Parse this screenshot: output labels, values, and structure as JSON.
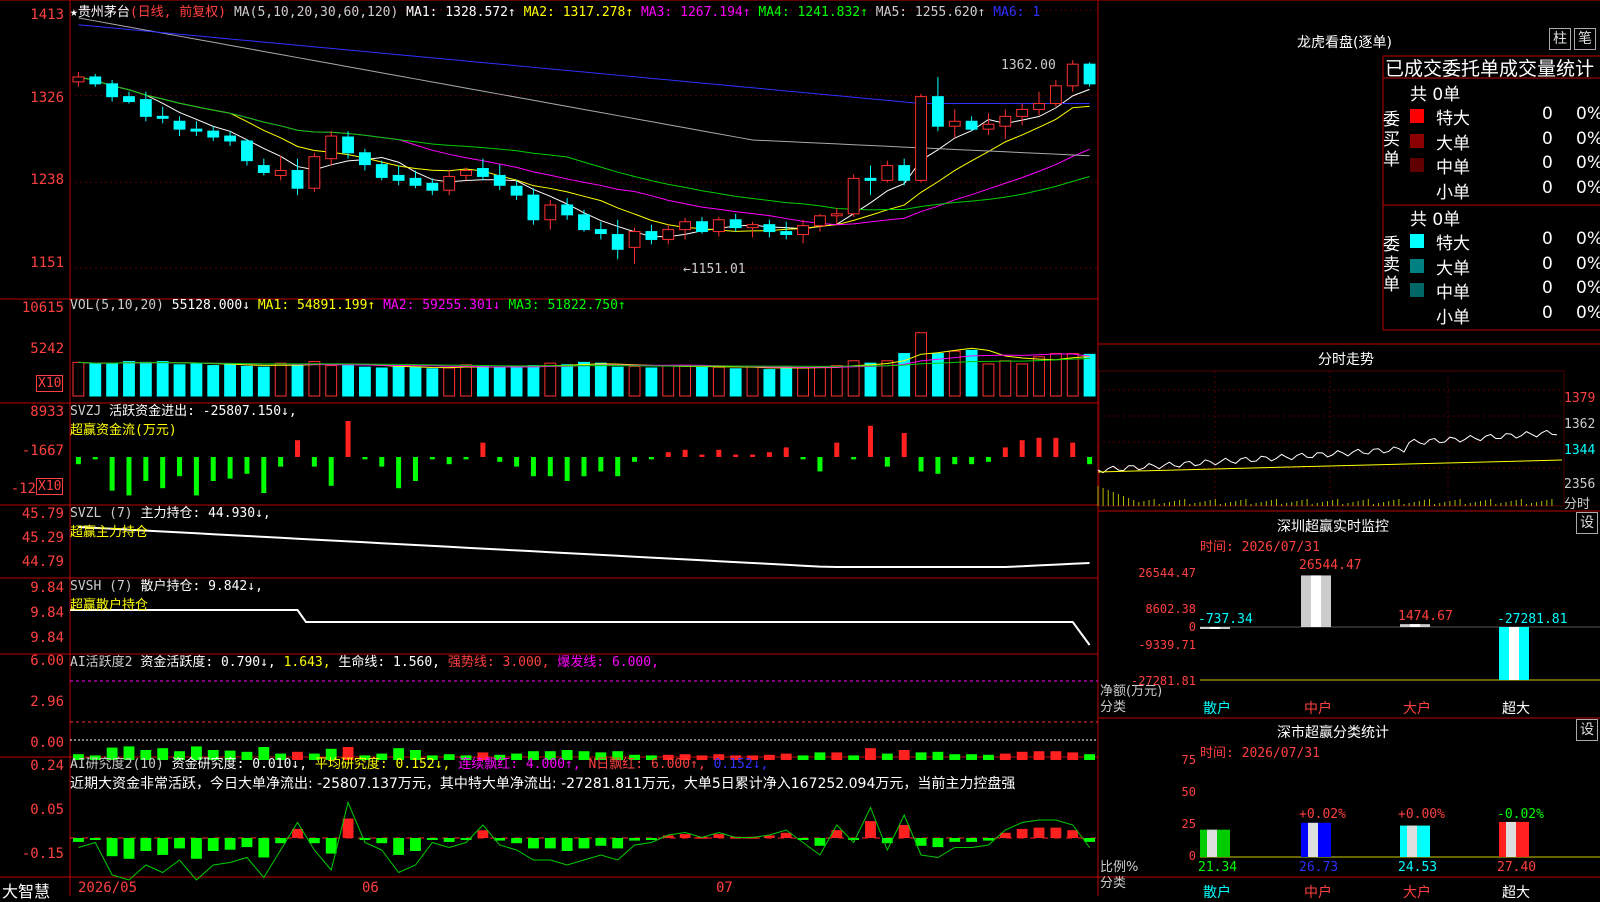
{
  "stock": {
    "name": "★贵州茅台",
    "mode": "(日线, 前复权)",
    "logo": "大智慧"
  },
  "price": {
    "header": {
      "ma_label": "MA(5,10,20,30,60,120)",
      "ma1": "MA1: 1328.572↑",
      "ma2": "MA2: 1317.278↑",
      "ma3": "MA3: 1267.194↑",
      "ma4": "MA4: 1241.832↑",
      "ma5": "MA5: 1255.620↑",
      "ma6": "MA6: 1"
    },
    "yticks": [
      "1413",
      "1326",
      "1238",
      "1151"
    ],
    "high_label": "1362.00",
    "low_label": "←1151.01"
  },
  "vol": {
    "header": {
      "label": "VOL(5,10,20)",
      "val": "55128.000↓",
      "ma1": "MA1: 54891.199↑",
      "ma2": "MA2: 59255.301↓",
      "ma3": "MA3: 51822.750↑"
    },
    "yticks": [
      "10615",
      "5242"
    ],
    "unit": "X10"
  },
  "svzj": {
    "header": {
      "label": "SVZJ",
      "text": "活跃资金进出: -25807.150↓,"
    },
    "sub": "超赢资金流(万元)",
    "yticks": [
      "8933",
      "-1667",
      "-12"
    ],
    "unit": "X10"
  },
  "svzl": {
    "header": {
      "label": "SVZL (7)",
      "text": "主力持仓: 44.930↓,"
    },
    "sub": "超赢主力持仓",
    "yticks": [
      "45.79",
      "45.29",
      "44.79"
    ]
  },
  "svsh": {
    "header": {
      "label": "SVSH (7)",
      "text": "散户持仓: 9.842↓,"
    },
    "sub": "超赢散户持仓",
    "yticks": [
      "9.84",
      "9.84",
      "9.84"
    ]
  },
  "ai1": {
    "header": {
      "label": "AI活跃度2",
      "t1": "资金活跃度: 0.790↓,",
      "t2": "1.643,",
      "t3": "生命线: 1.560,",
      "t4": "强势线: 3.000,",
      "t5": "爆发线: 6.000,"
    },
    "yticks": [
      "6.00",
      "2.96",
      "0.00"
    ]
  },
  "ai2": {
    "header": {
      "label": "AI研究度2(10)",
      "t1": "资金研究度: 0.010↓,",
      "t2": "平均研究度: 0.152↓,",
      "t3": "连续飘红: 4.000↑,",
      "t4": "N日飘红: 6.000↑,",
      "t5": "0.152↓,"
    },
    "note": "近期大资金非常活跃，今日大单净流出: -25807.137万元，其中特大单净流出: -27281.811万元，大单5日累计净入167252.094万元，当前主力控盘强",
    "yticks": [
      "0.24",
      "0.05",
      "-0.15"
    ]
  },
  "xaxis": [
    "2026/05",
    "06",
    "07"
  ],
  "lhb": {
    "title": "龙虎看盘(逐单)",
    "btn1": "柱",
    "btn2": "笔",
    "subtitle": "已成交委托单成交量统计",
    "buy": {
      "side": "委买单",
      "total": "共 0单",
      "rows": [
        {
          "label": "特大",
          "count": "0",
          "pct": "0%",
          "color": "#ff0000"
        },
        {
          "label": "大单",
          "count": "0",
          "pct": "0%",
          "color": "#8b0000"
        },
        {
          "label": "中单",
          "count": "0",
          "pct": "0%",
          "color": "#600000"
        },
        {
          "label": "小单",
          "count": "0",
          "pct": "0%",
          "color": "#000"
        }
      ]
    },
    "sell": {
      "side": "委卖单",
      "total": "共 0单",
      "rows": [
        {
          "label": "特大",
          "count": "0",
          "pct": "0%",
          "color": "#00ffff"
        },
        {
          "label": "大单",
          "count": "0",
          "pct": "0%",
          "color": "#008080"
        },
        {
          "label": "中单",
          "count": "0",
          "pct": "0%",
          "color": "#006666"
        },
        {
          "label": "小单",
          "count": "0",
          "pct": "0%",
          "color": "#000"
        }
      ]
    }
  },
  "fenshi": {
    "title": "分时走势",
    "yticks": [
      "1379",
      "1362",
      "1344",
      "2356",
      "分时"
    ]
  },
  "monitor": {
    "title": "深圳超赢实时监控",
    "btn": "设",
    "time": "时间: 2026/07/31",
    "yticks": [
      "26544.47",
      "8602.38",
      "0",
      "-9339.71",
      "-27281.81"
    ],
    "ylabel1": "净额(万元)",
    "ylabel2": "分类",
    "cats": [
      "散户",
      "中户",
      "大户",
      "超大"
    ],
    "vals": [
      "-737.34",
      "26544.47",
      "1474.67",
      "-27281.81"
    ]
  },
  "cls": {
    "title": "深市超赢分类统计",
    "btn": "设",
    "time": "时间: 2026/07/31",
    "yticks": [
      "75",
      "50",
      "25",
      "0"
    ],
    "ylabel1": "比例%",
    "ylabel2": "分类",
    "cats": [
      "散户",
      "中户",
      "大户",
      "超大"
    ],
    "vals": [
      "21.34",
      "26.73",
      "24.53",
      "27.40"
    ],
    "changes": [
      "",
      "+0.02%",
      "+0.00%",
      "-0.02%"
    ]
  },
  "chart_data": {
    "type": "bar",
    "title": "贵州茅台",
    "candles": [
      [
        1340,
        1350,
        1335,
        1345
      ],
      [
        1345,
        1348,
        1335,
        1338
      ],
      [
        1338,
        1342,
        1320,
        1325
      ],
      [
        1325,
        1330,
        1318,
        1320
      ],
      [
        1322,
        1330,
        1300,
        1305
      ],
      [
        1305,
        1315,
        1298,
        1303
      ],
      [
        1300,
        1305,
        1285,
        1292
      ],
      [
        1292,
        1300,
        1285,
        1290
      ],
      [
        1290,
        1295,
        1280,
        1284
      ],
      [
        1285,
        1290,
        1275,
        1280
      ],
      [
        1280,
        1282,
        1255,
        1260
      ],
      [
        1255,
        1262,
        1245,
        1248
      ],
      [
        1245,
        1265,
        1240,
        1250
      ],
      [
        1250,
        1262,
        1225,
        1232
      ],
      [
        1232,
        1268,
        1228,
        1264
      ],
      [
        1262,
        1290,
        1255,
        1285
      ],
      [
        1284,
        1290,
        1262,
        1268
      ],
      [
        1268,
        1272,
        1250,
        1256
      ],
      [
        1256,
        1260,
        1240,
        1243
      ],
      [
        1245,
        1255,
        1235,
        1240
      ],
      [
        1242,
        1250,
        1232,
        1235
      ],
      [
        1237,
        1242,
        1225,
        1230
      ],
      [
        1230,
        1250,
        1225,
        1244
      ],
      [
        1245,
        1253,
        1240,
        1250
      ],
      [
        1252,
        1262,
        1240,
        1244
      ],
      [
        1245,
        1256,
        1230,
        1235
      ],
      [
        1234,
        1240,
        1220,
        1225
      ],
      [
        1225,
        1232,
        1195,
        1200
      ],
      [
        1200,
        1220,
        1190,
        1215
      ],
      [
        1215,
        1222,
        1200,
        1205
      ],
      [
        1205,
        1210,
        1188,
        1190
      ],
      [
        1190,
        1198,
        1180,
        1186
      ],
      [
        1185,
        1200,
        1160,
        1170
      ],
      [
        1172,
        1192,
        1155,
        1188
      ],
      [
        1188,
        1195,
        1175,
        1180
      ],
      [
        1180,
        1195,
        1175,
        1190
      ],
      [
        1190,
        1202,
        1180,
        1198
      ],
      [
        1198,
        1203,
        1186,
        1188
      ],
      [
        1188,
        1203,
        1183,
        1200
      ],
      [
        1200,
        1206,
        1188,
        1192
      ],
      [
        1192,
        1198,
        1182,
        1195
      ],
      [
        1195,
        1200,
        1182,
        1188
      ],
      [
        1188,
        1198,
        1180,
        1185
      ],
      [
        1185,
        1200,
        1176,
        1194
      ],
      [
        1194,
        1206,
        1188,
        1204
      ],
      [
        1204,
        1212,
        1195,
        1206
      ],
      [
        1206,
        1246,
        1203,
        1242
      ],
      [
        1242,
        1255,
        1225,
        1240
      ],
      [
        1240,
        1260,
        1238,
        1255
      ],
      [
        1255,
        1262,
        1235,
        1240
      ],
      [
        1240,
        1328,
        1238,
        1325
      ],
      [
        1325,
        1345,
        1290,
        1295
      ],
      [
        1295,
        1312,
        1283,
        1300
      ],
      [
        1300,
        1305,
        1290,
        1292
      ],
      [
        1292,
        1308,
        1286,
        1297
      ],
      [
        1295,
        1312,
        1282,
        1305
      ],
      [
        1305,
        1318,
        1296,
        1312
      ],
      [
        1312,
        1330,
        1306,
        1318
      ],
      [
        1318,
        1342,
        1315,
        1336
      ],
      [
        1336,
        1362,
        1330,
        1358
      ],
      [
        1358,
        1360,
        1335,
        1338
      ]
    ],
    "volume": [
      4200,
      4000,
      4100,
      4300,
      4200,
      4300,
      3900,
      4000,
      3800,
      4000,
      3700,
      3600,
      4100,
      3900,
      4300,
      3800,
      3900,
      3600,
      3500,
      3700,
      3600,
      3400,
      3500,
      3900,
      3700,
      3600,
      3700,
      3800,
      4100,
      3900,
      4200,
      4100,
      3600,
      3700,
      3500,
      3800,
      3800,
      3600,
      3600,
      3400,
      3700,
      3300,
      3600,
      3500,
      3600,
      3800,
      4400,
      4100,
      4400,
      5300,
      7900,
      5300,
      5600,
      5700,
      4000,
      4400,
      4000,
      4900,
      5300,
      5300,
      5200
    ],
    "flow": [
      -3,
      -1,
      -14,
      -16,
      -10,
      -13,
      -8,
      -16,
      -10,
      -9,
      -7,
      -15,
      -4,
      7,
      -4,
      -12,
      15,
      -1,
      -4,
      -13,
      -10,
      -1,
      -3,
      -1,
      6,
      -2,
      -4,
      -8,
      -8,
      -10,
      -8,
      -6,
      -8,
      -2,
      -1,
      2,
      3,
      1,
      3,
      1,
      1,
      2,
      4,
      -1,
      -6,
      6,
      -1,
      13,
      -4,
      10,
      -6,
      -7,
      -3,
      -3,
      -2,
      4,
      7,
      8,
      8,
      6,
      -3
    ],
    "xlabel": "",
    "ylabel": ""
  }
}
